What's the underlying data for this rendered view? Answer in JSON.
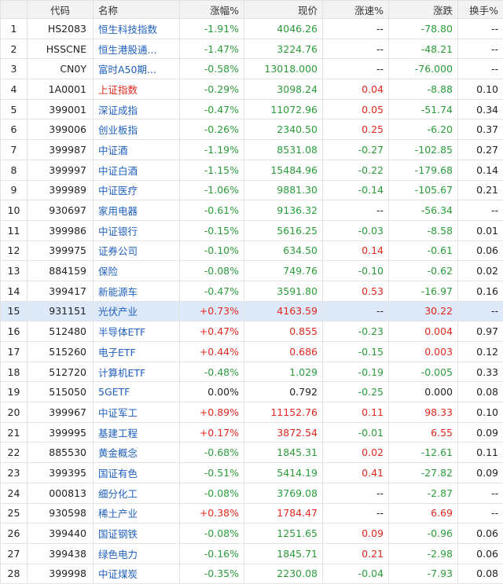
{
  "columns": [
    "",
    "代码",
    "名称",
    "涨幅%",
    "现价",
    "涨速%",
    "涨跌",
    "换手%"
  ],
  "rows": [
    {
      "idx": "1",
      "code": "HS2083",
      "name": "恒生科技指数",
      "chg_pct": "-1.91%",
      "price": "4046.26",
      "speed": "--",
      "change": "-78.80",
      "turnover": "--",
      "dir": "down",
      "speed_dir": "flat",
      "name_dir": "normal"
    },
    {
      "idx": "2",
      "code": "HSSCNE",
      "name": "恒生港股通...",
      "chg_pct": "-1.47%",
      "price": "3224.76",
      "speed": "--",
      "change": "-48.21",
      "turnover": "--",
      "dir": "down",
      "speed_dir": "flat",
      "name_dir": "normal"
    },
    {
      "idx": "3",
      "code": "CN0Y",
      "name": "富时A50期...",
      "chg_pct": "-0.58%",
      "price": "13018.000",
      "speed": "--",
      "change": "-76.000",
      "turnover": "--",
      "dir": "down",
      "speed_dir": "flat",
      "name_dir": "normal"
    },
    {
      "idx": "4",
      "code": "1A0001",
      "name": "上证指数",
      "chg_pct": "-0.29%",
      "price": "3098.24",
      "speed": "0.04",
      "change": "-8.88",
      "turnover": "0.10",
      "dir": "down",
      "speed_dir": "up",
      "name_dir": "red"
    },
    {
      "idx": "5",
      "code": "399001",
      "name": "深证成指",
      "chg_pct": "-0.47%",
      "price": "11072.96",
      "speed": "0.05",
      "change": "-51.74",
      "turnover": "0.34",
      "dir": "down",
      "speed_dir": "up",
      "name_dir": "normal"
    },
    {
      "idx": "6",
      "code": "399006",
      "name": "创业板指",
      "chg_pct": "-0.26%",
      "price": "2340.50",
      "speed": "0.25",
      "change": "-6.20",
      "turnover": "0.37",
      "dir": "down",
      "speed_dir": "up",
      "name_dir": "normal"
    },
    {
      "idx": "7",
      "code": "399987",
      "name": "中证酒",
      "chg_pct": "-1.19%",
      "price": "8531.08",
      "speed": "-0.27",
      "change": "-102.85",
      "turnover": "0.27",
      "dir": "down",
      "speed_dir": "down",
      "name_dir": "normal"
    },
    {
      "idx": "8",
      "code": "399997",
      "name": "中证白酒",
      "chg_pct": "-1.15%",
      "price": "15484.96",
      "speed": "-0.22",
      "change": "-179.68",
      "turnover": "0.14",
      "dir": "down",
      "speed_dir": "down",
      "name_dir": "normal"
    },
    {
      "idx": "9",
      "code": "399989",
      "name": "中证医疗",
      "chg_pct": "-1.06%",
      "price": "9881.30",
      "speed": "-0.14",
      "change": "-105.67",
      "turnover": "0.21",
      "dir": "down",
      "speed_dir": "down",
      "name_dir": "normal"
    },
    {
      "idx": "10",
      "code": "930697",
      "name": "家用电器",
      "chg_pct": "-0.61%",
      "price": "9136.32",
      "speed": "--",
      "change": "-56.34",
      "turnover": "--",
      "dir": "down",
      "speed_dir": "flat",
      "name_dir": "normal"
    },
    {
      "idx": "11",
      "code": "399986",
      "name": "中证银行",
      "chg_pct": "-0.15%",
      "price": "5616.25",
      "speed": "-0.03",
      "change": "-8.58",
      "turnover": "0.01",
      "dir": "down",
      "speed_dir": "down",
      "name_dir": "normal"
    },
    {
      "idx": "12",
      "code": "399975",
      "name": "证券公司",
      "chg_pct": "-0.10%",
      "price": "634.50",
      "speed": "0.14",
      "change": "-0.61",
      "turnover": "0.06",
      "dir": "down",
      "speed_dir": "up",
      "name_dir": "normal"
    },
    {
      "idx": "13",
      "code": "884159",
      "name": "保险",
      "chg_pct": "-0.08%",
      "price": "749.76",
      "speed": "-0.10",
      "change": "-0.62",
      "turnover": "0.02",
      "dir": "down",
      "speed_dir": "down",
      "name_dir": "normal"
    },
    {
      "idx": "14",
      "code": "399417",
      "name": "新能源车",
      "chg_pct": "-0.47%",
      "price": "3591.80",
      "speed": "0.53",
      "change": "-16.97",
      "turnover": "0.16",
      "dir": "down",
      "speed_dir": "up",
      "name_dir": "normal"
    },
    {
      "idx": "15",
      "code": "931151",
      "name": "光伏产业",
      "chg_pct": "+0.73%",
      "price": "4163.59",
      "speed": "--",
      "change": "30.22",
      "turnover": "--",
      "dir": "up",
      "speed_dir": "flat",
      "name_dir": "normal",
      "selected": true
    },
    {
      "idx": "16",
      "code": "512480",
      "name": "半导体ETF",
      "chg_pct": "+0.47%",
      "price": "0.855",
      "speed": "-0.23",
      "change": "0.004",
      "turnover": "0.97",
      "dir": "up",
      "speed_dir": "down",
      "name_dir": "normal"
    },
    {
      "idx": "17",
      "code": "515260",
      "name": "电子ETF",
      "chg_pct": "+0.44%",
      "price": "0.686",
      "speed": "-0.15",
      "change": "0.003",
      "turnover": "0.12",
      "dir": "up",
      "speed_dir": "down",
      "name_dir": "normal"
    },
    {
      "idx": "18",
      "code": "512720",
      "name": "计算机ETF",
      "chg_pct": "-0.48%",
      "price": "1.029",
      "speed": "-0.19",
      "change": "-0.005",
      "turnover": "0.33",
      "dir": "down",
      "speed_dir": "down",
      "name_dir": "normal"
    },
    {
      "idx": "19",
      "code": "515050",
      "name": "5GETF",
      "chg_pct": "0.00%",
      "price": "0.792",
      "speed": "-0.25",
      "change": "0.000",
      "turnover": "0.08",
      "dir": "flat",
      "speed_dir": "down",
      "name_dir": "normal"
    },
    {
      "idx": "20",
      "code": "399967",
      "name": "中证军工",
      "chg_pct": "+0.89%",
      "price": "11152.76",
      "speed": "0.11",
      "change": "98.33",
      "turnover": "0.10",
      "dir": "up",
      "speed_dir": "up",
      "name_dir": "normal"
    },
    {
      "idx": "21",
      "code": "399995",
      "name": "基建工程",
      "chg_pct": "+0.17%",
      "price": "3872.54",
      "speed": "-0.01",
      "change": "6.55",
      "turnover": "0.09",
      "dir": "up",
      "speed_dir": "down",
      "name_dir": "normal"
    },
    {
      "idx": "22",
      "code": "885530",
      "name": "黄金概念",
      "chg_pct": "-0.68%",
      "price": "1845.31",
      "speed": "0.02",
      "change": "-12.61",
      "turnover": "0.11",
      "dir": "down",
      "speed_dir": "up",
      "name_dir": "normal"
    },
    {
      "idx": "23",
      "code": "399395",
      "name": "国证有色",
      "chg_pct": "-0.51%",
      "price": "5414.19",
      "speed": "0.41",
      "change": "-27.82",
      "turnover": "0.09",
      "dir": "down",
      "speed_dir": "up",
      "name_dir": "normal"
    },
    {
      "idx": "24",
      "code": "000813",
      "name": "细分化工",
      "chg_pct": "-0.08%",
      "price": "3769.08",
      "speed": "--",
      "change": "-2.87",
      "turnover": "--",
      "dir": "down",
      "speed_dir": "flat",
      "name_dir": "normal"
    },
    {
      "idx": "25",
      "code": "930598",
      "name": "稀土产业",
      "chg_pct": "+0.38%",
      "price": "1784.47",
      "speed": "--",
      "change": "6.69",
      "turnover": "--",
      "dir": "up",
      "speed_dir": "flat",
      "name_dir": "normal"
    },
    {
      "idx": "26",
      "code": "399440",
      "name": "国证钢铁",
      "chg_pct": "-0.08%",
      "price": "1251.65",
      "speed": "0.09",
      "change": "-0.96",
      "turnover": "0.06",
      "dir": "down",
      "speed_dir": "up",
      "name_dir": "normal"
    },
    {
      "idx": "27",
      "code": "399438",
      "name": "绿色电力",
      "chg_pct": "-0.16%",
      "price": "1845.71",
      "speed": "0.21",
      "change": "-2.98",
      "turnover": "0.06",
      "dir": "down",
      "speed_dir": "up",
      "name_dir": "normal"
    },
    {
      "idx": "28",
      "code": "399998",
      "name": "中证煤炭",
      "chg_pct": "-0.35%",
      "price": "2230.08",
      "speed": "-0.04",
      "change": "-7.93",
      "turnover": "0.08",
      "dir": "down",
      "speed_dir": "down",
      "name_dir": "normal"
    }
  ]
}
